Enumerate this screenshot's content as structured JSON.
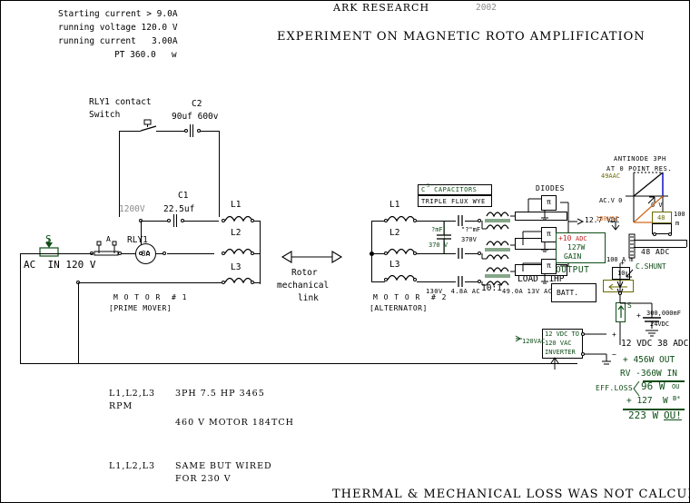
{
  "header": {
    "company": "ARK RESEARCH",
    "year": "2002",
    "title": "EXPERIMENT ON MAGNETIC ROTO AMPLIFICATION"
  },
  "specs": {
    "line1": "Starting current > 9.0A",
    "line2": "running voltage 120.0 V",
    "line3": "running current   3.00A",
    "line4": "PT 360.0   w"
  },
  "relay_branch": {
    "label1": "RLY1 contact",
    "label2": "Switch",
    "c2_name": "C2",
    "c2_value": "90uf 600v",
    "c1_name": "C1",
    "c1_value": "22.5uf",
    "c1_voltage": "1200V"
  },
  "motor1": {
    "supply": "AC  IN 120 V",
    "switch_label": "S",
    "ammeter_label": "A",
    "relay_name": "RLY1",
    "relay_rating": "8A",
    "coil_l1": "L1",
    "coil_l2": "L2",
    "coil_l3": "L3",
    "name": "M O T O R  # 1",
    "role": "[PRIME MOVER]"
  },
  "link": {
    "line1": "Rotor",
    "line2": "mechanical",
    "line3": "link"
  },
  "motor2": {
    "coil_l1": "L1",
    "coil_l2": "L2",
    "coil_l3": "L3",
    "name": "M O T O R  # 2",
    "role": "[ALTERNATOR]",
    "cap_title": "C  CAPACITORS",
    "cap_title_sup": "3",
    "cap_subtitle": "TRIPLE FLUX WYE",
    "cap1_value": "?mF",
    "cap1_voltage": "370 V",
    "cap2_value": "\"?\"mF",
    "cap2_voltage": "370V",
    "xfmr_in": "130V  4.8A AC",
    "xfmr_ratio": "10:1",
    "xfmr_out": "49.0A 13V AC",
    "load": "LOAD  1HP"
  },
  "rectifier": {
    "diodes_label": "DIODES",
    "dc_bus": "12.7 VDC",
    "gain_amps": "+10",
    "gain_amps_unit": "ADC",
    "gain_watts": "127W",
    "gain_label": "GAIN",
    "output_label": "OUTPUT",
    "shunt_meter": "100 A m",
    "shunt_label": "C.SHUNT",
    "battery_label": "BATT."
  },
  "graph": {
    "title1": "ANTINODE 3PH",
    "title2": "AT 0 POINT RES.",
    "y_top": "49AAC",
    "y_mid": "AC.V 0",
    "y_bot": "130VAC",
    "marker": "0 V"
  },
  "battery_meter": {
    "value": "48",
    "unit": "100 A m",
    "reading": "48 ADC"
  },
  "storage": {
    "cap_value": "300,000mF",
    "cap_voltage": "24VDC",
    "switch_label": "S",
    "dc_reading": "12 VDC 38 ADC",
    "plus": "+",
    "minus": "−"
  },
  "inverter": {
    "line1": "12 VDC TO",
    "line2": "120 VAC",
    "line3": "INVERTER",
    "ac_out": "120VAC"
  },
  "efficiency": {
    "out": "+ 456W OUT",
    "in": "RV -360W IN",
    "loss_label": "EFF.LOSS",
    "loss_value": "96 W",
    "loss_unit": "OU",
    "batt": "+ 127  W",
    "batt_sup": "B*",
    "total": "223 W",
    "total_unit": "OU!"
  },
  "notes": {
    "n1_a": "L1,L2,L3",
    "n1_b": "3PH 7.5 HP 3465",
    "n1_c": "RPM",
    "n1_d": "460 V MOTOR 184TCH",
    "n2_a": "L1,L2,L3",
    "n2_b": "SAME BUT WIRED",
    "n2_c": "FOR 230 V"
  },
  "footer": {
    "text": "THERMAL & MECHANICAL LOSS WAS NOT CALCULATED"
  },
  "colors": {
    "green": "#0d4d16",
    "olive": "#6b6b00",
    "orange": "#d2691e",
    "red": "#c62828",
    "blue": "#0000c8",
    "grey": "#8a8a8a"
  }
}
